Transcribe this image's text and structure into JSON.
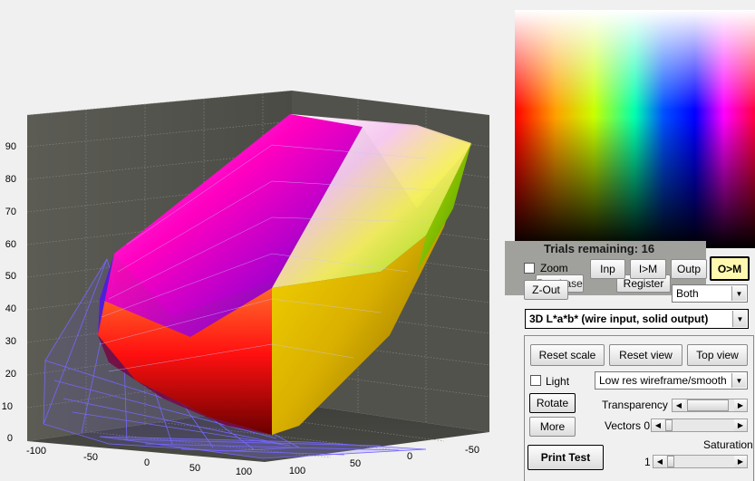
{
  "plot": {
    "z_ticks": [
      "0",
      "10",
      "20",
      "30",
      "40",
      "50",
      "60",
      "70",
      "80",
      "90"
    ],
    "x_ticks": [
      "-100",
      "-50",
      "0",
      "50",
      "100"
    ],
    "y_ticks": [
      "100",
      "50",
      "0",
      "-50"
    ],
    "colors": {
      "background": "#f0f0f0",
      "axes_bg": "#4a4a46",
      "wall_left": "#55554f",
      "grid": "#9a9a90",
      "wireframe": "#6a5cff"
    }
  },
  "trials": {
    "label": "Trials remaining: 16"
  },
  "buttons": {
    "inp": "Inp",
    "i_m": "I>M",
    "outp": "Outp",
    "o_m": "O>M",
    "purchase": "Purchase",
    "register": "Register",
    "z_out": "Z-Out",
    "reset_scale": "Reset scale",
    "reset_view": "Reset view",
    "top_view": "Top view",
    "rotate": "Rotate",
    "more": "More",
    "print_test": "Print Test"
  },
  "zoom": {
    "label": "Zoom",
    "checked": false
  },
  "light": {
    "label": "Light",
    "checked": false
  },
  "display_select": {
    "value": "Both"
  },
  "mode_select": {
    "value": "3D L*a*b* (wire input, solid output)"
  },
  "render_select": {
    "value": "Low res wireframe/smooth"
  },
  "transparency": {
    "label": "Transparency 1",
    "level": 0.85
  },
  "vectors": {
    "label": "Vectors 0",
    "level": 0.0
  },
  "saturation": {
    "label": "Saturation",
    "value": "1",
    "level": 0.0
  },
  "accent": {
    "o_m_bg": "#fff9b0",
    "trials_bg": "#a0a09c"
  }
}
